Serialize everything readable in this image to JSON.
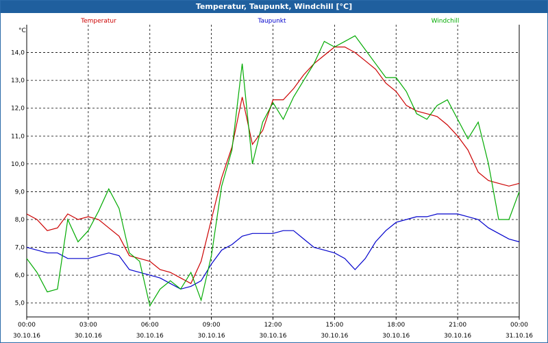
{
  "window": {
    "title": "Temperatur, Taupunkt, Windchill [°C]"
  },
  "chart_data": {
    "type": "line",
    "title": "Temperatur, Taupunkt, Windchill [°C]",
    "ylabel": "°C",
    "xlabel": "",
    "ylim": [
      4.5,
      15.0
    ],
    "xlim": [
      0,
      24
    ],
    "grid": true,
    "y_ticks": [
      "5,0",
      "6,0",
      "7,0",
      "8,0",
      "9,0",
      "10,0",
      "11,0",
      "12,0",
      "13,0",
      "14,0"
    ],
    "x_ticks": [
      {
        "time": "00:00",
        "date": "30.10.16"
      },
      {
        "time": "03:00",
        "date": "30.10.16"
      },
      {
        "time": "06:00",
        "date": "30.10.16"
      },
      {
        "time": "09:00",
        "date": "30.10.16"
      },
      {
        "time": "12:00",
        "date": "30.10.16"
      },
      {
        "time": "15:00",
        "date": "30.10.16"
      },
      {
        "time": "18:00",
        "date": "30.10.16"
      },
      {
        "time": "21:00",
        "date": "30.10.16"
      },
      {
        "time": "00:00",
        "date": "31.10.16"
      }
    ],
    "series": [
      {
        "name": "Temperatur",
        "color": "#cc0000",
        "x": [
          0,
          0.5,
          1,
          1.5,
          2,
          2.5,
          3,
          3.5,
          4,
          4.5,
          5,
          5.5,
          6,
          6.5,
          7,
          7.5,
          8,
          8.5,
          9,
          9.5,
          10,
          10.5,
          11,
          11.5,
          12,
          12.5,
          13,
          13.5,
          14,
          14.5,
          15,
          15.5,
          16,
          16.5,
          17,
          17.5,
          18,
          18.5,
          19,
          19.5,
          20,
          20.5,
          21,
          21.5,
          22,
          22.5,
          23,
          23.5,
          24
        ],
        "values": [
          8.2,
          8.0,
          7.6,
          7.7,
          8.2,
          8.0,
          8.1,
          8.0,
          7.7,
          7.4,
          6.7,
          6.6,
          6.5,
          6.2,
          6.1,
          5.9,
          5.7,
          6.5,
          8.0,
          9.5,
          10.6,
          12.4,
          10.7,
          11.2,
          12.3,
          12.3,
          12.7,
          13.2,
          13.6,
          13.9,
          14.2,
          14.2,
          14.0,
          13.7,
          13.4,
          12.9,
          12.6,
          12.1,
          11.9,
          11.8,
          11.7,
          11.4,
          11.0,
          10.5,
          9.7,
          9.4,
          9.3,
          9.2,
          9.3
        ]
      },
      {
        "name": "Taupunkt",
        "color": "#0000cc",
        "x": [
          0,
          0.5,
          1,
          1.5,
          2,
          2.5,
          3,
          3.5,
          4,
          4.5,
          5,
          5.5,
          6,
          6.5,
          7,
          7.5,
          8,
          8.5,
          9,
          9.5,
          10,
          10.5,
          11,
          11.5,
          12,
          12.5,
          13,
          13.5,
          14,
          14.5,
          15,
          15.5,
          16,
          16.5,
          17,
          17.5,
          18,
          18.5,
          19,
          19.5,
          20,
          20.5,
          21,
          21.5,
          22,
          22.5,
          23,
          23.5,
          24
        ],
        "values": [
          7.0,
          6.9,
          6.8,
          6.8,
          6.6,
          6.6,
          6.6,
          6.7,
          6.8,
          6.7,
          6.2,
          6.1,
          6.0,
          5.9,
          5.7,
          5.5,
          5.6,
          5.8,
          6.4,
          6.9,
          7.1,
          7.4,
          7.5,
          7.5,
          7.5,
          7.6,
          7.6,
          7.3,
          7.0,
          6.9,
          6.8,
          6.6,
          6.2,
          6.6,
          7.2,
          7.6,
          7.9,
          8.0,
          8.1,
          8.1,
          8.2,
          8.2,
          8.2,
          8.1,
          8.0,
          7.7,
          7.5,
          7.3,
          7.2
        ]
      },
      {
        "name": "Windchill",
        "color": "#00aa00",
        "x": [
          0,
          0.5,
          1,
          1.5,
          2,
          2.5,
          3,
          3.5,
          4,
          4.5,
          5,
          5.5,
          6,
          6.5,
          7,
          7.5,
          8,
          8.5,
          9,
          9.5,
          10,
          10.5,
          11,
          11.5,
          12,
          12.5,
          13,
          13.5,
          14,
          14.5,
          15,
          15.5,
          16,
          16.5,
          17,
          17.5,
          18,
          18.5,
          19,
          19.5,
          20,
          20.5,
          21,
          21.5,
          22,
          22.5,
          23,
          23.5,
          24
        ],
        "values": [
          6.6,
          6.1,
          5.4,
          5.5,
          8.0,
          7.2,
          7.6,
          8.3,
          9.1,
          8.4,
          6.8,
          6.5,
          4.9,
          5.5,
          5.8,
          5.5,
          6.1,
          5.1,
          6.7,
          9.2,
          10.5,
          13.6,
          10.0,
          11.5,
          12.2,
          11.6,
          12.4,
          13.0,
          13.6,
          14.4,
          14.2,
          14.4,
          14.6,
          14.1,
          13.6,
          13.1,
          13.1,
          12.6,
          11.8,
          11.6,
          12.1,
          12.3,
          11.6,
          10.9,
          11.5,
          10.0,
          8.0,
          8.0,
          9.0
        ]
      }
    ]
  }
}
